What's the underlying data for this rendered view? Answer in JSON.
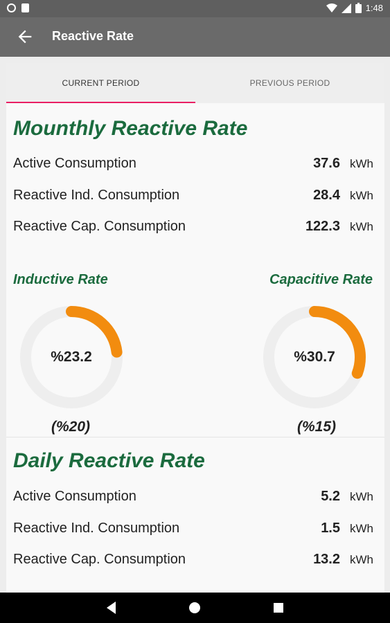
{
  "status": {
    "time": "1:48"
  },
  "header": {
    "title": "Reactive Rate"
  },
  "tabs": [
    {
      "label": "CURRENT PERIOD"
    },
    {
      "label": "PREVIOUS PERIOD"
    }
  ],
  "monthly": {
    "title": "Mounthly Reactive Rate",
    "rows": [
      {
        "label": "Active Consumption",
        "value": "37.6",
        "unit": "kWh"
      },
      {
        "label": "Reactive Ind. Consumption",
        "value": "28.4",
        "unit": "kWh"
      },
      {
        "label": "Reactive Cap. Consumption",
        "value": "122.3",
        "unit": "kWh"
      }
    ],
    "inductive": {
      "label": "Inductive Rate",
      "value_text": "%23.2",
      "percent": 23.2,
      "limit": "(%20)"
    },
    "capacitive": {
      "label": "Capacitive Rate",
      "value_text": "%30.7",
      "percent": 30.7,
      "limit": "(%15)"
    }
  },
  "daily": {
    "title": "Daily Reactive Rate",
    "rows": [
      {
        "label": "Active Consumption",
        "value": "5.2",
        "unit": "kWh"
      },
      {
        "label": "Reactive Ind. Consumption",
        "value": "1.5",
        "unit": "kWh"
      },
      {
        "label": "Reactive Cap. Consumption",
        "value": "13.2",
        "unit": "kWh"
      }
    ]
  },
  "colors": {
    "accent_green": "#1b6b3e",
    "gauge_orange": "#f28c0f",
    "tab_indicator": "#e91e63",
    "gauge_track": "#eeeeee"
  },
  "icons": {
    "back": "arrow-left-icon",
    "nav_back": "triangle-back-icon",
    "nav_home": "circle-home-icon",
    "nav_recent": "square-recent-icon"
  }
}
